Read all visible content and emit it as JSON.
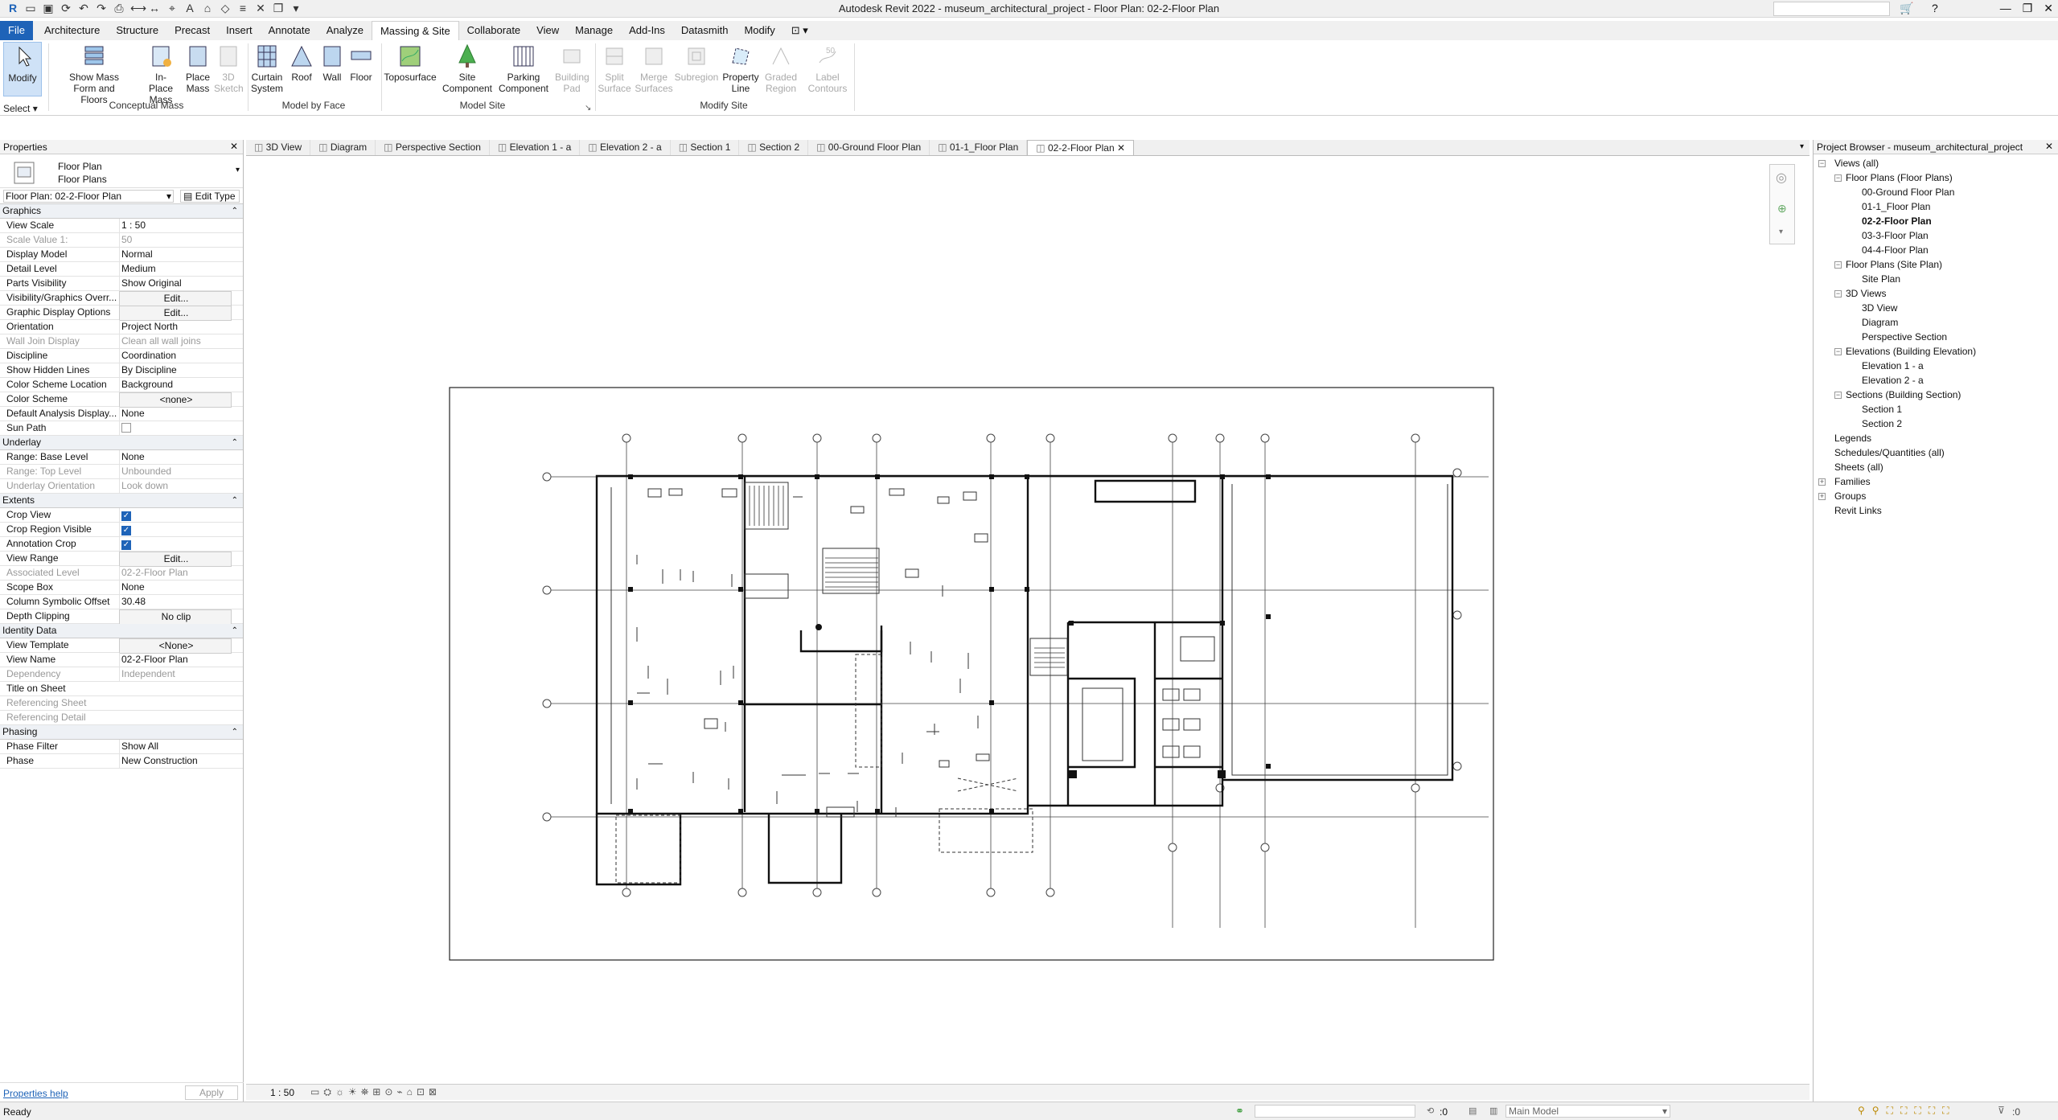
{
  "app": {
    "title": "Autodesk Revit 2022 - museum_architectural_project - Floor Plan: 02-2-Floor Plan"
  },
  "menu": {
    "tabs": [
      "File",
      "Architecture",
      "Structure",
      "Precast",
      "Insert",
      "Annotate",
      "Analyze",
      "Massing & Site",
      "Collaborate",
      "View",
      "Manage",
      "Add-Ins",
      "Datasmith",
      "Modify"
    ],
    "active": "Massing & Site"
  },
  "ribbon": {
    "modify": "Modify",
    "select": "Select",
    "show_mass": "Show Mass Form and Floors",
    "inplace_mass": "In-Place Mass",
    "place_mass": "Place Mass",
    "sketch3d": "3D Sketch",
    "curtain_system": "Curtain System",
    "roof": "Roof",
    "wall": "Wall",
    "floor": "Floor",
    "toposurface": "Toposurface",
    "site_component": "Site Component",
    "parking_component": "Parking Component",
    "building_pad": "Building Pad",
    "split_surface": "Split Surface",
    "merge_surfaces": "Merge Surfaces",
    "subregion": "Subregion",
    "property_line": "Property Line",
    "graded_region": "Graded Region",
    "label_contours": "Label Contours",
    "groups": [
      "Conceptual Mass",
      "Model by Face",
      "Model Site",
      "Modify Site"
    ]
  },
  "properties": {
    "title": "Properties",
    "type_line1": "Floor Plan",
    "type_line2": "Floor Plans",
    "instance": "Floor Plan: 02-2-Floor Plan",
    "edit_type": "Edit Type",
    "help": "Properties help",
    "apply": "Apply",
    "sections": [
      {
        "name": "Graphics",
        "rows": [
          {
            "k": "View Scale",
            "v": "1 : 50"
          },
          {
            "k": "Scale Value    1:",
            "v": "50",
            "grey": true
          },
          {
            "k": "Display Model",
            "v": "Normal"
          },
          {
            "k": "Detail Level",
            "v": "Medium"
          },
          {
            "k": "Parts Visibility",
            "v": "Show Original"
          },
          {
            "k": "Visibility/Graphics Overr...",
            "v": "Edit...",
            "btn": true
          },
          {
            "k": "Graphic Display Options",
            "v": "Edit...",
            "btn": true
          },
          {
            "k": "Orientation",
            "v": "Project North"
          },
          {
            "k": "Wall Join Display",
            "v": "Clean all wall joins",
            "grey": true
          },
          {
            "k": "Discipline",
            "v": "Coordination"
          },
          {
            "k": "Show Hidden Lines",
            "v": "By Discipline"
          },
          {
            "k": "Color Scheme Location",
            "v": "Background"
          },
          {
            "k": "Color Scheme",
            "v": "<none>",
            "btn": true
          },
          {
            "k": "Default Analysis Display...",
            "v": "None"
          },
          {
            "k": "Sun Path",
            "v": "",
            "check": false
          }
        ]
      },
      {
        "name": "Underlay",
        "rows": [
          {
            "k": "Range: Base Level",
            "v": "None"
          },
          {
            "k": "Range: Top Level",
            "v": "Unbounded",
            "grey": true
          },
          {
            "k": "Underlay Orientation",
            "v": "Look down",
            "grey": true
          }
        ]
      },
      {
        "name": "Extents",
        "rows": [
          {
            "k": "Crop View",
            "v": "",
            "check": true
          },
          {
            "k": "Crop Region Visible",
            "v": "",
            "check": true
          },
          {
            "k": "Annotation Crop",
            "v": "",
            "check": true
          },
          {
            "k": "View Range",
            "v": "Edit...",
            "btn": true
          },
          {
            "k": "Associated Level",
            "v": "02-2-Floor Plan",
            "grey": true
          },
          {
            "k": "Scope Box",
            "v": "None"
          },
          {
            "k": "Column Symbolic Offset",
            "v": "30.48"
          },
          {
            "k": "Depth Clipping",
            "v": "No clip",
            "btn": true
          }
        ]
      },
      {
        "name": "Identity Data",
        "rows": [
          {
            "k": "View Template",
            "v": "<None>",
            "btn": true
          },
          {
            "k": "View Name",
            "v": "02-2-Floor Plan"
          },
          {
            "k": "Dependency",
            "v": "Independent",
            "grey": true
          },
          {
            "k": "Title on Sheet",
            "v": ""
          },
          {
            "k": "Referencing Sheet",
            "v": "",
            "grey": true
          },
          {
            "k": "Referencing Detail",
            "v": "",
            "grey": true
          }
        ]
      },
      {
        "name": "Phasing",
        "rows": [
          {
            "k": "Phase Filter",
            "v": "Show All"
          },
          {
            "k": "Phase",
            "v": "New Construction"
          }
        ]
      }
    ]
  },
  "view_tabs": [
    "3D View",
    "Diagram",
    "Perspective Section",
    "Elevation 1 - a",
    "Elevation 2 - a",
    "Section 1",
    "Section 2",
    "00-Ground Floor Plan",
    "01-1_Floor Plan",
    "02-2-Floor Plan"
  ],
  "active_view_tab": "02-2-Floor Plan",
  "browser": {
    "title": "Project Browser - museum_architectural_project",
    "nodes": {
      "views_all": "Views (all)",
      "fp": "Floor Plans (Floor Plans)",
      "fp0": "00-Ground Floor Plan",
      "fp1": "01-1_Floor Plan",
      "fp2": "02-2-Floor Plan",
      "fp3": "03-3-Floor Plan",
      "fp4": "04-4-Floor Plan",
      "site": "Floor Plans (Site Plan)",
      "site_plan": "Site Plan",
      "v3d": "3D Views",
      "v3d1": "3D View",
      "v3d2": "Diagram",
      "v3d3": "Perspective Section",
      "elev": "Elevations (Building Elevation)",
      "elev1": "Elevation 1 - a",
      "elev2": "Elevation 2 - a",
      "sec": "Sections (Building Section)",
      "sec1": "Section 1",
      "sec2": "Section 2",
      "legends": "Legends",
      "schedules": "Schedules/Quantities (all)",
      "sheets": "Sheets (all)",
      "families": "Families",
      "groups": "Groups",
      "links": "Revit Links"
    }
  },
  "viewbar": {
    "scale": "1 : 50"
  },
  "status": {
    "ready": "Ready",
    "zero": ":0",
    "model": "Main Model"
  },
  "colors": {
    "accent": "#1e63b8"
  }
}
